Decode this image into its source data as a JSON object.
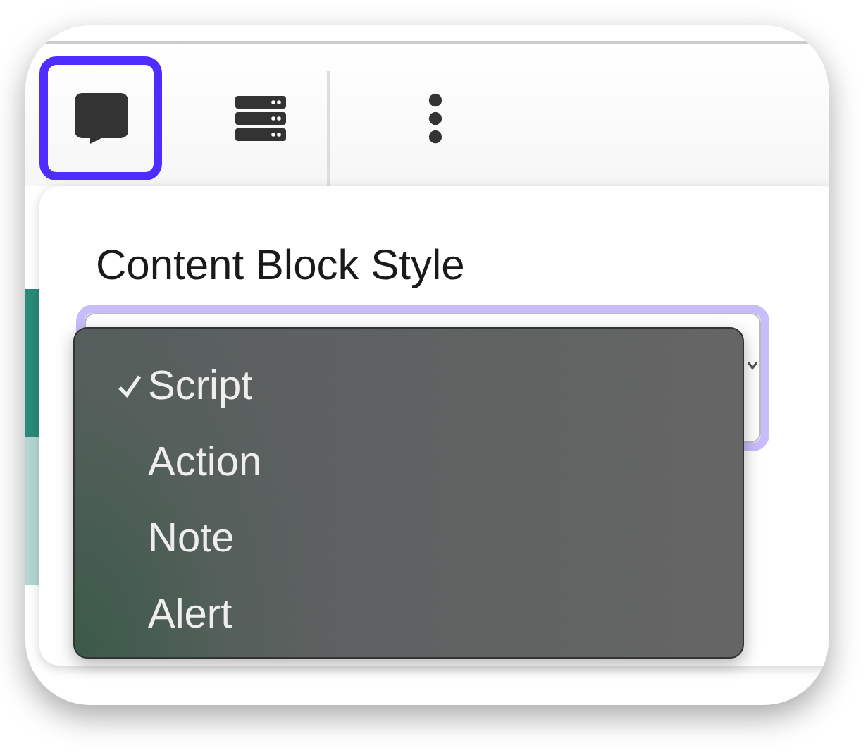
{
  "toolbar": {
    "buttons": [
      {
        "kind": "comment",
        "selected": true
      },
      {
        "kind": "server",
        "selected": false
      },
      {
        "kind": "more",
        "selected": false
      }
    ]
  },
  "popover": {
    "label": "Content Block Style",
    "options": [
      {
        "label": "Script",
        "selected": true
      },
      {
        "label": "Action",
        "selected": false
      },
      {
        "label": "Note",
        "selected": false
      },
      {
        "label": "Alert",
        "selected": false
      }
    ]
  }
}
